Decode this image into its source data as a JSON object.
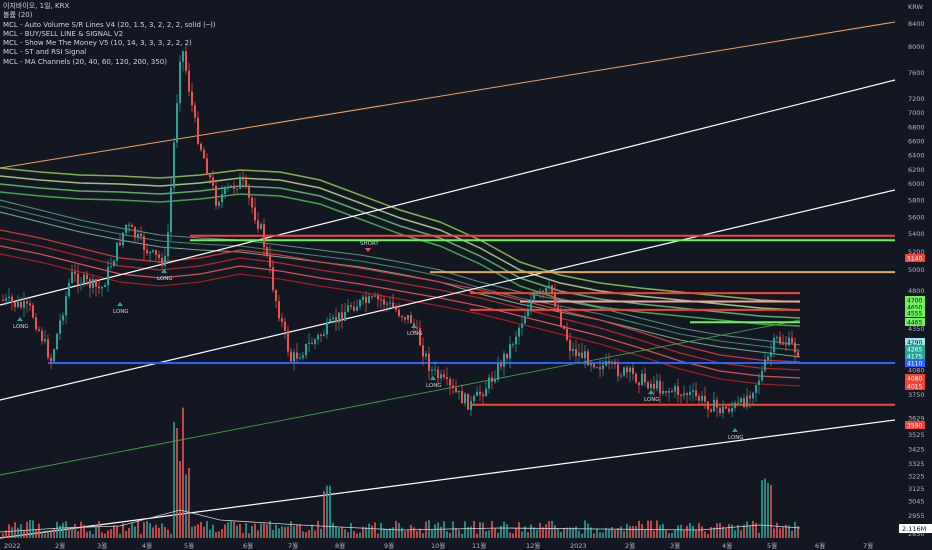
{
  "header": {
    "symbol_line": "이지바이오, 1일, KRX",
    "indicators": [
      "볼륨 (20)",
      "MCL - Auto Volume S/R Lines V4 (20, 1.5, 3, 2, 2, 2, solid (─))",
      "MCL - BUY/SELL LINE & SIGNAL V2",
      "MCL - Show Me The Money V5 (10, 14, 3, 3, 3, 2, 2, 2)",
      "MCL - ST and RSI Signal",
      "MCL - MA Channels (20, 40, 60, 120, 200, 350)"
    ]
  },
  "colors": {
    "background": "#131722",
    "candle_up": "#26a69a",
    "candle_down": "#ef5350",
    "support_line": "#2962ff",
    "sr_red": "#f44336",
    "sr_green": "#6cf25a",
    "trend_white": "#ffffff",
    "trend_orange": "#f0a060"
  },
  "chart_data": {
    "type": "candlestick",
    "currency": "KRW",
    "y_ticks": [
      8400,
      8000,
      7600,
      7200,
      7000,
      6800,
      6600,
      6400,
      6200,
      6000,
      5800,
      5600,
      5400,
      5200,
      5000,
      4800,
      4600,
      4350,
      4290,
      4265,
      4175,
      4110,
      4080,
      4015,
      3750,
      3629,
      3590,
      3525,
      3425,
      3325,
      3225,
      3125,
      3045,
      2955,
      2850
    ],
    "x_ticks": [
      "2022",
      "2월",
      "3월",
      "4월",
      "5월",
      "6월",
      "7월",
      "8월",
      "9월",
      "10월",
      "11월",
      "12월",
      "2023",
      "2월",
      "3월",
      "4월",
      "5월",
      "6월",
      "7월"
    ],
    "price_tags": [
      {
        "label": "4700",
        "color": "#6cf25a",
        "text_color": "#131722"
      },
      {
        "label": "4650",
        "color": "#6cf25a",
        "text_color": "#131722"
      },
      {
        "label": "4555",
        "color": "#6cf25a",
        "text_color": "#131722"
      },
      {
        "label": "4465",
        "color": "#6cf25a",
        "text_color": "#131722"
      },
      {
        "label": "5140",
        "color": "#f44336",
        "text_color": "#ffffff"
      },
      {
        "label": "4290",
        "color": "#9be7ef",
        "text_color": "#131722"
      },
      {
        "label": "4265",
        "color": "#26a69a",
        "text_color": "#ffffff"
      },
      {
        "label": "4175",
        "color": "#26a69a",
        "text_color": "#ffffff"
      },
      {
        "label": "4110",
        "color": "#2962ff",
        "text_color": "#ffffff"
      },
      {
        "label": "4080",
        "color": "#f44336",
        "text_color": "#ffffff"
      },
      {
        "label": "4015",
        "color": "#f44336",
        "text_color": "#ffffff"
      },
      {
        "label": "3590",
        "color": "#f44336",
        "text_color": "#ffffff"
      }
    ],
    "volume_label": "2.116M",
    "signals": [
      {
        "label": "LONG",
        "type": "long"
      },
      {
        "label": "LONG",
        "type": "long"
      },
      {
        "label": "LONG",
        "type": "long"
      },
      {
        "label": "SHORT",
        "type": "short"
      },
      {
        "label": "LONG",
        "type": "long"
      },
      {
        "label": "LONG",
        "type": "long"
      },
      {
        "label": "LONG",
        "type": "long"
      },
      {
        "label": "LONG",
        "type": "long"
      }
    ],
    "horizontal_levels": [
      {
        "price": 5380,
        "color": "#f44336"
      },
      {
        "price": 5330,
        "color": "#6cf25a"
      },
      {
        "price": 4980,
        "color": "#e3a94a"
      },
      {
        "price": 4780,
        "color": "#f44336"
      },
      {
        "price": 4700,
        "color": "#f4a39a"
      },
      {
        "price": 4620,
        "color": "#f44336"
      },
      {
        "price": 4450,
        "color": "#6cf25a"
      },
      {
        "price": 4110,
        "color": "#2962ff"
      },
      {
        "price": 3700,
        "color": "#f44336"
      }
    ],
    "grid": false
  }
}
